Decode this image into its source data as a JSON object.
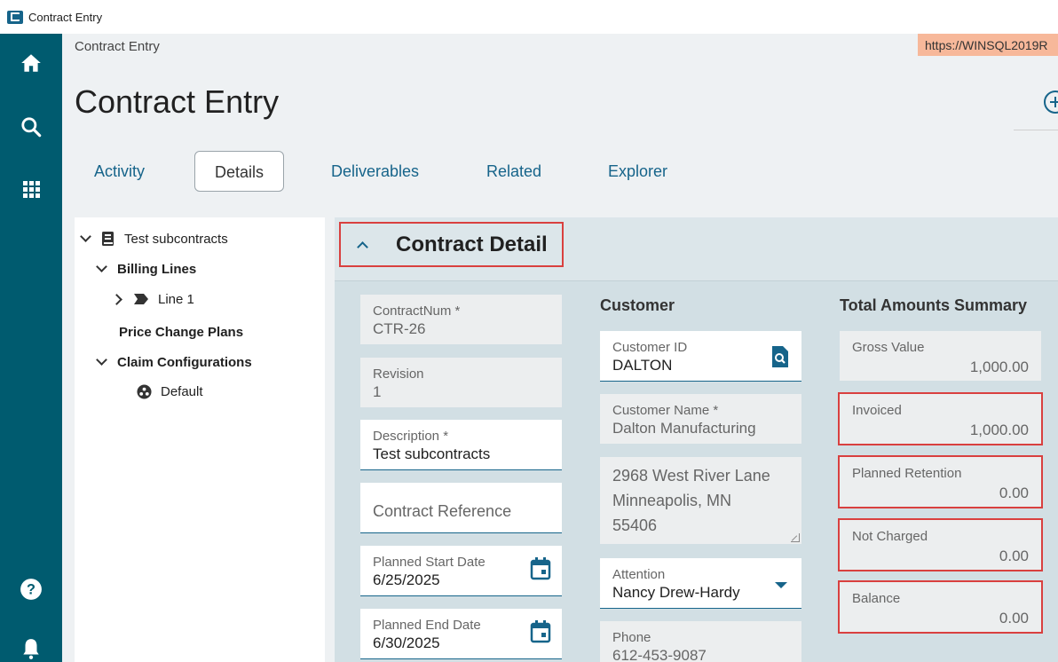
{
  "window": {
    "title": "Contract Entry"
  },
  "breadcrumb": "Contract Entry",
  "url_badge": "https://WINSQL2019R",
  "page_title": "Contract Entry",
  "tabs": [
    {
      "label": "Activity"
    },
    {
      "label": "Details"
    },
    {
      "label": "Deliverables"
    },
    {
      "label": "Related"
    },
    {
      "label": "Explorer"
    }
  ],
  "active_tab": "Details",
  "tree": {
    "root": "Test subcontracts",
    "billing_lines": "Billing Lines",
    "line1": "Line 1",
    "price_change_plans": "Price Change Plans",
    "claim_configurations": "Claim Configurations",
    "default": "Default"
  },
  "detail": {
    "section_title": "Contract Detail",
    "left": {
      "contract_num": {
        "label": "ContractNum *",
        "value": "CTR-26"
      },
      "revision": {
        "label": "Revision",
        "value": "1"
      },
      "description": {
        "label": "Description *",
        "value": "Test subcontracts"
      },
      "contract_reference": {
        "placeholder": "Contract Reference"
      },
      "planned_start": {
        "label": "Planned Start Date",
        "value": "6/25/2025"
      },
      "planned_end": {
        "label": "Planned End Date",
        "value": "6/30/2025"
      }
    },
    "customer": {
      "title": "Customer",
      "customer_id": {
        "label": "Customer ID",
        "value": "DALTON"
      },
      "customer_name": {
        "label": "Customer Name *",
        "value": "Dalton Manufacturing"
      },
      "address": {
        "line1": "2968 West River Lane",
        "line2": "Minneapolis, MN",
        "line3": "55406"
      },
      "attention": {
        "label": "Attention",
        "value": "Nancy Drew-Hardy"
      },
      "phone": {
        "label": "Phone",
        "value": "612-453-9087"
      }
    },
    "summary": {
      "title": "Total Amounts Summary",
      "gross_value": {
        "label": "Gross Value",
        "value": "1,000.00"
      },
      "invoiced": {
        "label": "Invoiced",
        "value": "1,000.00"
      },
      "planned_retention": {
        "label": "Planned Retention",
        "value": "0.00"
      },
      "not_charged": {
        "label": "Not Charged",
        "value": "0.00"
      },
      "balance": {
        "label": "Balance",
        "value": "0.00"
      }
    }
  },
  "colors": {
    "rail": "#005b6f",
    "accent": "#16648a",
    "highlight": "#d9403f",
    "url_badge": "#f7b89a"
  },
  "icons": [
    "home-icon",
    "search-icon",
    "apps-grid-icon",
    "help-icon",
    "bell-icon",
    "add-circle-icon",
    "book-icon",
    "tag-icon",
    "config-icon",
    "lookup-icon",
    "calendar-icon",
    "dropdown-icon"
  ]
}
